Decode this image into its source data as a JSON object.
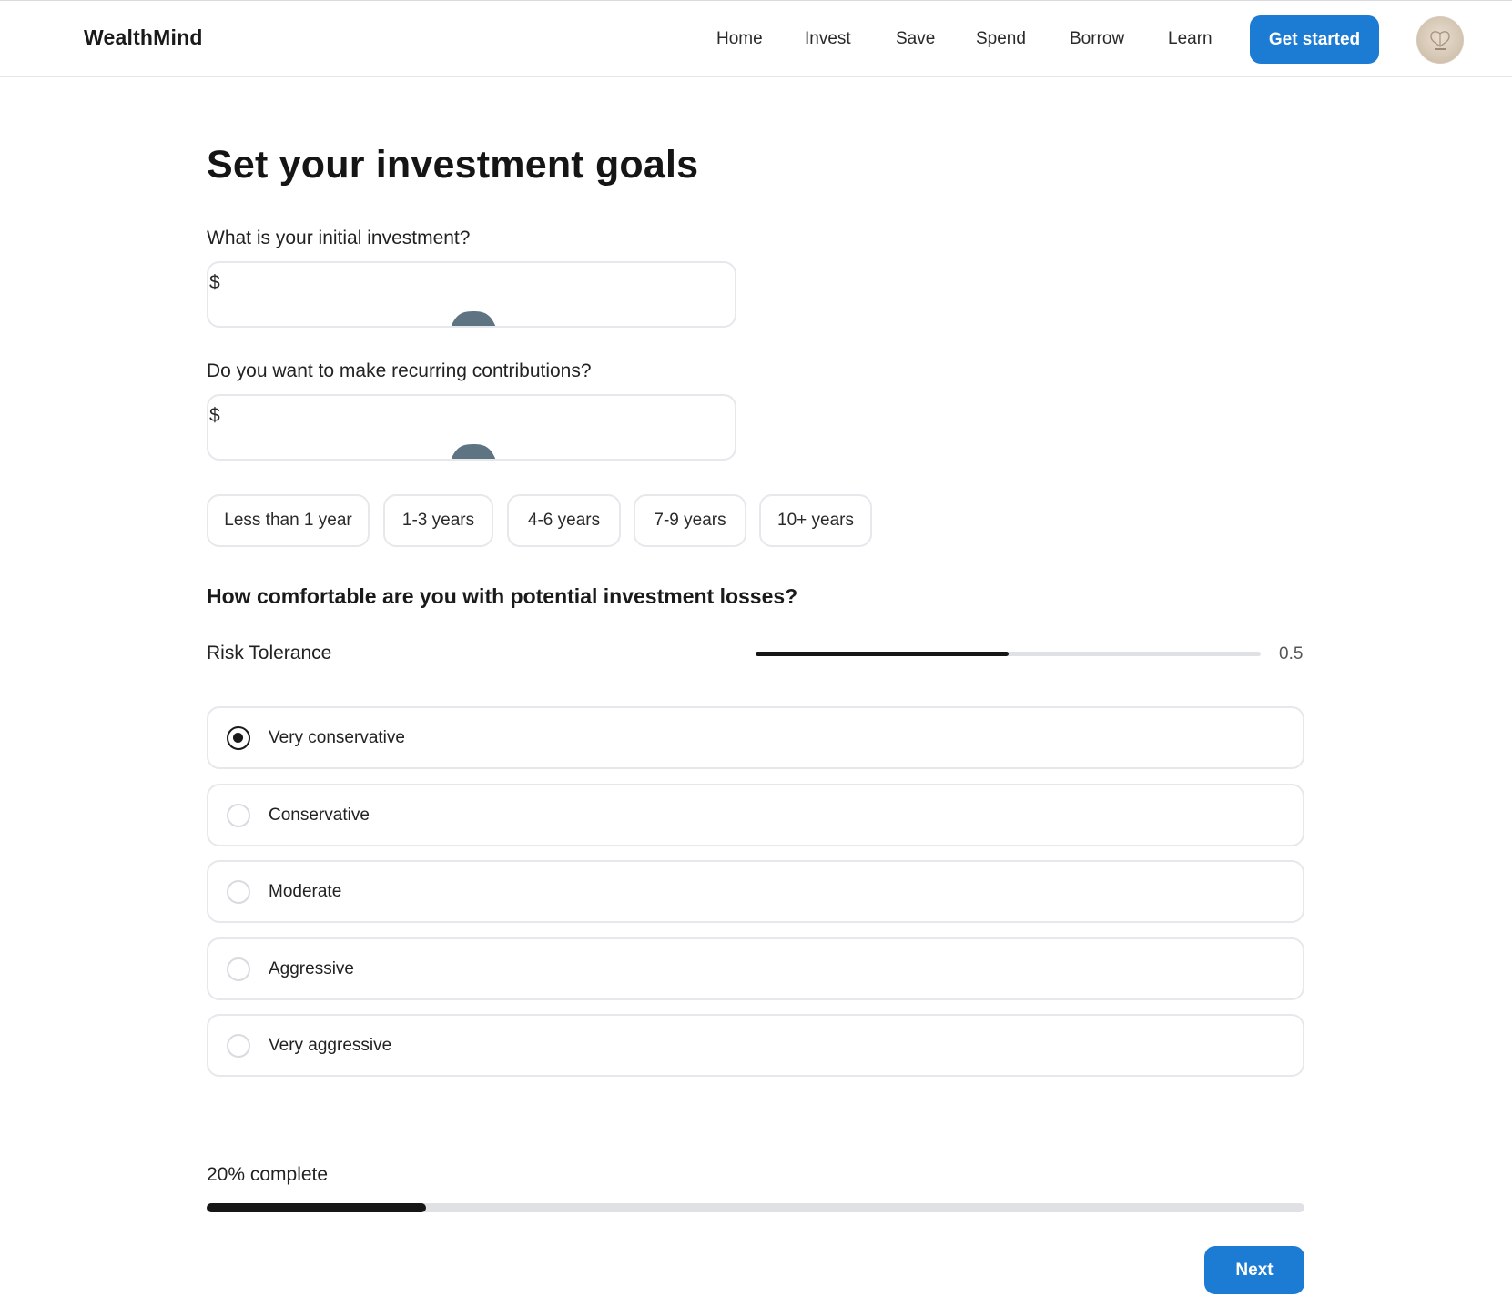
{
  "header": {
    "brand": "WealthMind",
    "nav": [
      "Home",
      "Invest",
      "Save",
      "Spend",
      "Borrow",
      "Learn"
    ],
    "cta": "Get started",
    "avatar_icon": "user-avatar"
  },
  "main": {
    "title": "Set your investment goals",
    "initial": {
      "label": "What is your initial investment?",
      "currency": "$",
      "value": ""
    },
    "recurring": {
      "label": "Do you want to make recurring contributions?",
      "currency": "$",
      "value": ""
    },
    "horizons": [
      "Less than 1 year",
      "1-3 years",
      "4-6 years",
      "7-9 years",
      "10+ years"
    ],
    "risk_question": "How comfortable are you with potential investment losses?",
    "risk_label": "Risk Tolerance",
    "risk_value": "0.5",
    "risk_level": 0.5,
    "options": [
      "Very conservative",
      "Conservative",
      "Moderate",
      "Aggressive",
      "Very aggressive"
    ],
    "selected_option": "Very conservative",
    "progress_label": "20% complete",
    "progress": 0.2,
    "next": "Next"
  },
  "colors": {
    "accent": "#1c7bd2",
    "track": "#dfe1e5",
    "fill": "#161616",
    "border": "#e7e8ec"
  }
}
